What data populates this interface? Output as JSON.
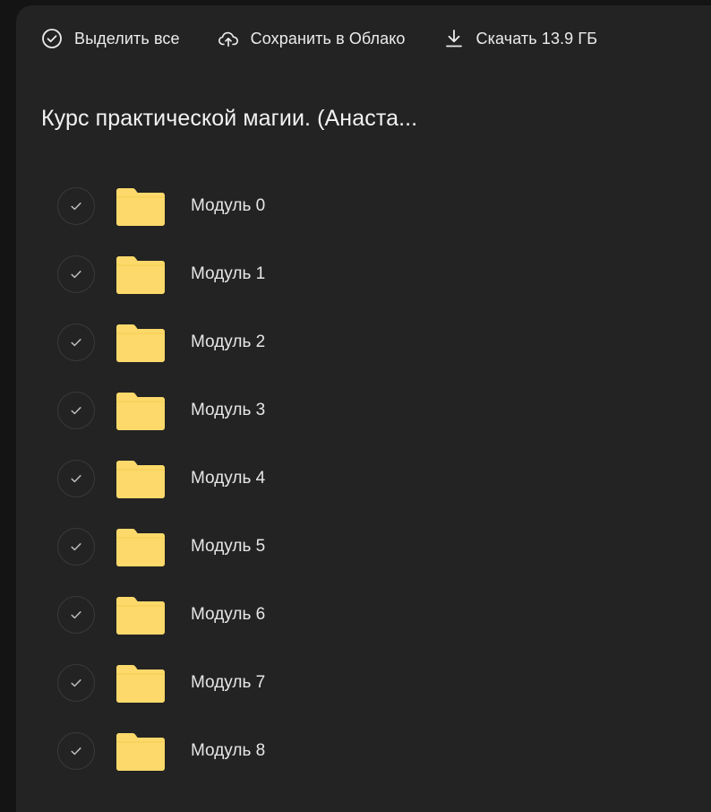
{
  "toolbar": {
    "select_all": {
      "label": "Выделить все",
      "icon": "check-circle-icon"
    },
    "save_to_cloud": {
      "label": "Сохранить в Облако",
      "icon": "cloud-upload-icon"
    },
    "download": {
      "label": "Скачать 13.9 ГБ",
      "icon": "download-icon"
    }
  },
  "folder_title": "Курс практической магии. (Анаста...",
  "colors": {
    "background": "#232323",
    "folder": "#FCD96A",
    "text": "#ececec"
  },
  "items": [
    {
      "name": "Модуль 0",
      "icon": "folder-icon"
    },
    {
      "name": "Модуль 1",
      "icon": "folder-icon"
    },
    {
      "name": "Модуль 2",
      "icon": "folder-icon"
    },
    {
      "name": "Модуль 3",
      "icon": "folder-icon"
    },
    {
      "name": "Модуль 4",
      "icon": "folder-icon"
    },
    {
      "name": "Модуль 5",
      "icon": "folder-icon"
    },
    {
      "name": "Модуль 6",
      "icon": "folder-icon"
    },
    {
      "name": "Модуль 7",
      "icon": "folder-icon"
    },
    {
      "name": "Модуль 8",
      "icon": "folder-icon"
    }
  ]
}
